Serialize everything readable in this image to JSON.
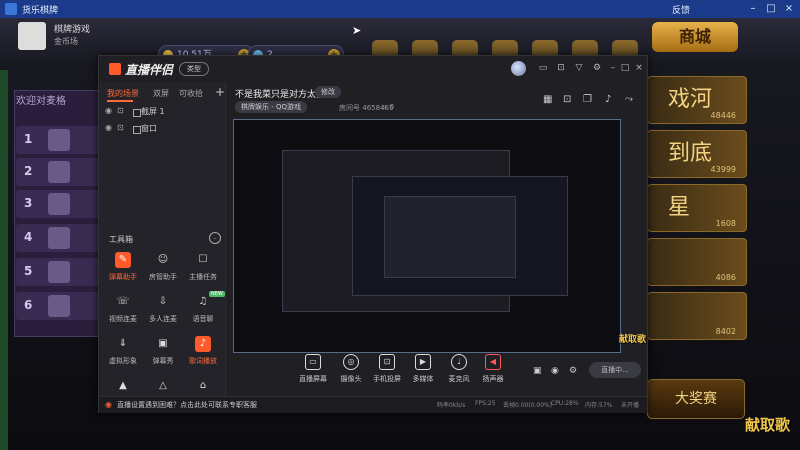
{
  "game": {
    "window_title": "货乐棋牌",
    "top_links": [
      "反馈",
      "1"
    ],
    "coins_label": "10.51万",
    "diamonds_label": "2",
    "user_name": "棋牌游戏",
    "user_tag": "金币场",
    "shop_label": "商城",
    "left_panel_title": "欢迎对麦格",
    "left_panel_tab": "欢迎",
    "ranks": [
      "1",
      "2",
      "3",
      "4",
      "5",
      "6"
    ],
    "room_cards": [
      {
        "title": "戏河",
        "value": "48446"
      },
      {
        "title": "到底",
        "value": "43999"
      },
      {
        "title": "星",
        "value": "1608"
      },
      {
        "title": "",
        "value": "4086"
      },
      {
        "title": "",
        "value": "8402"
      }
    ],
    "big_button_label": "大奖赛",
    "overlay_text": "献取歌"
  },
  "app": {
    "logo_text": "直播伴侣",
    "version_label": "类型",
    "title_icons": [
      "chat-icon",
      "lock-icon",
      "filter-icon",
      "gear-icon",
      "minimize-icon",
      "maximize-icon",
      "close-icon"
    ],
    "sidebar": {
      "tabs": [
        "我的场景",
        "双屏",
        "可收拾"
      ],
      "add": "+",
      "scenes": [
        {
          "label": "截屏 1"
        },
        {
          "label": "窗口"
        }
      ],
      "toolbox_title": "工具箱",
      "tools": [
        {
          "label": "弹幕助手",
          "icon": "danmu-icon",
          "hot": true
        },
        {
          "label": "房管助手",
          "icon": "admin-icon",
          "hot": false
        },
        {
          "label": "主播任务",
          "icon": "task-icon",
          "hot": false
        },
        {
          "label": "视频连麦",
          "icon": "video-link-icon",
          "hot": false
        },
        {
          "label": "多人连麦",
          "icon": "multi-link-icon",
          "hot": false
        },
        {
          "label": "语音聊",
          "icon": "voice-icon",
          "hot": false
        },
        {
          "label": "虚拟形象",
          "icon": "avatar-icon",
          "hot": false
        },
        {
          "label": "弹幕秀",
          "icon": "show-icon",
          "hot": false
        },
        {
          "label": "歌词播放",
          "icon": "lyrics-icon",
          "hot": true
        },
        {
          "label": "",
          "icon": "more-icon-1",
          "hot": false
        },
        {
          "label": "",
          "icon": "more-icon-2",
          "hot": false
        },
        {
          "label": "",
          "icon": "more-icon-3",
          "hot": false
        }
      ]
    },
    "room": {
      "title": "不是我菜只是对方太强",
      "edit_label": "修改",
      "category": "棋牌娱乐 - QQ游戏",
      "id_label": "房间号",
      "id_value": "4658465",
      "heat": "0"
    },
    "controls": [
      {
        "label": "直播屏幕",
        "icon": "screen-icon"
      },
      {
        "label": "摄像头",
        "icon": "camera-icon"
      },
      {
        "label": "手机投屏",
        "icon": "phone-icon"
      },
      {
        "label": "多媒体",
        "icon": "media-icon"
      },
      {
        "label": "麦克风",
        "icon": "mic-icon"
      },
      {
        "label": "扬声器",
        "icon": "speaker-icon"
      }
    ],
    "start_label": "直播中...",
    "notice": "直播设置遇到困难？点击此处可联系专职客服",
    "stats": [
      "码率0kb/s",
      "FPS:25",
      "丢帧0.00(0.00%)",
      "CPU:28%",
      "内存:57%",
      "未开播"
    ]
  }
}
